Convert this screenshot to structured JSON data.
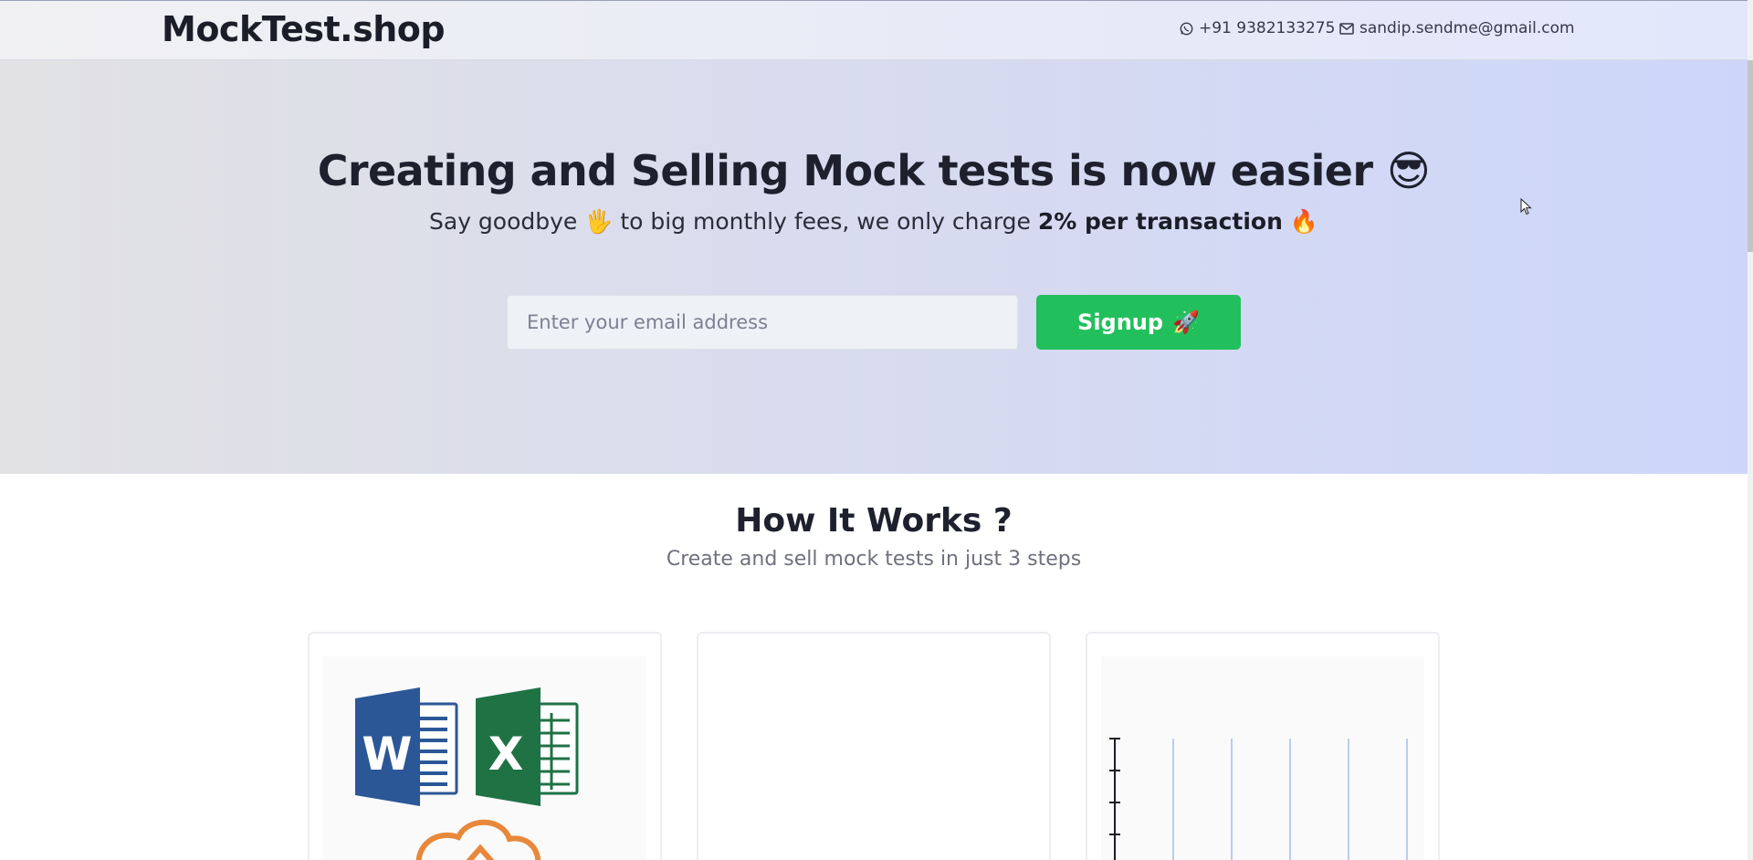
{
  "header": {
    "brand": "MockTest.shop",
    "phone": "+91 9382133275",
    "email": "sandip.sendme@gmail.com"
  },
  "hero": {
    "title": "Creating and Selling Mock tests is now easier 😎",
    "subtitle_prefix": "Say goodbye 🖐 to big monthly fees, we only charge ",
    "subtitle_bold": "2% per transaction",
    "subtitle_suffix": " 🔥",
    "email_placeholder": "Enter your email address",
    "signup_label": "Signup",
    "signup_emoji": "🚀"
  },
  "how_it_works": {
    "title": "How It Works ?",
    "subtitle": "Create and sell mock tests in just 3 steps"
  },
  "cards": [
    {
      "icons": [
        "word-icon",
        "excel-icon",
        "cloud-upload-icon"
      ]
    },
    {
      "icons": []
    },
    {
      "icons": [
        "chart-preview-icon"
      ]
    }
  ],
  "colors": {
    "accent_green": "#22c05c",
    "word_blue": "#2b5797",
    "excel_green": "#1f7244",
    "upload_orange": "#e8883a"
  }
}
